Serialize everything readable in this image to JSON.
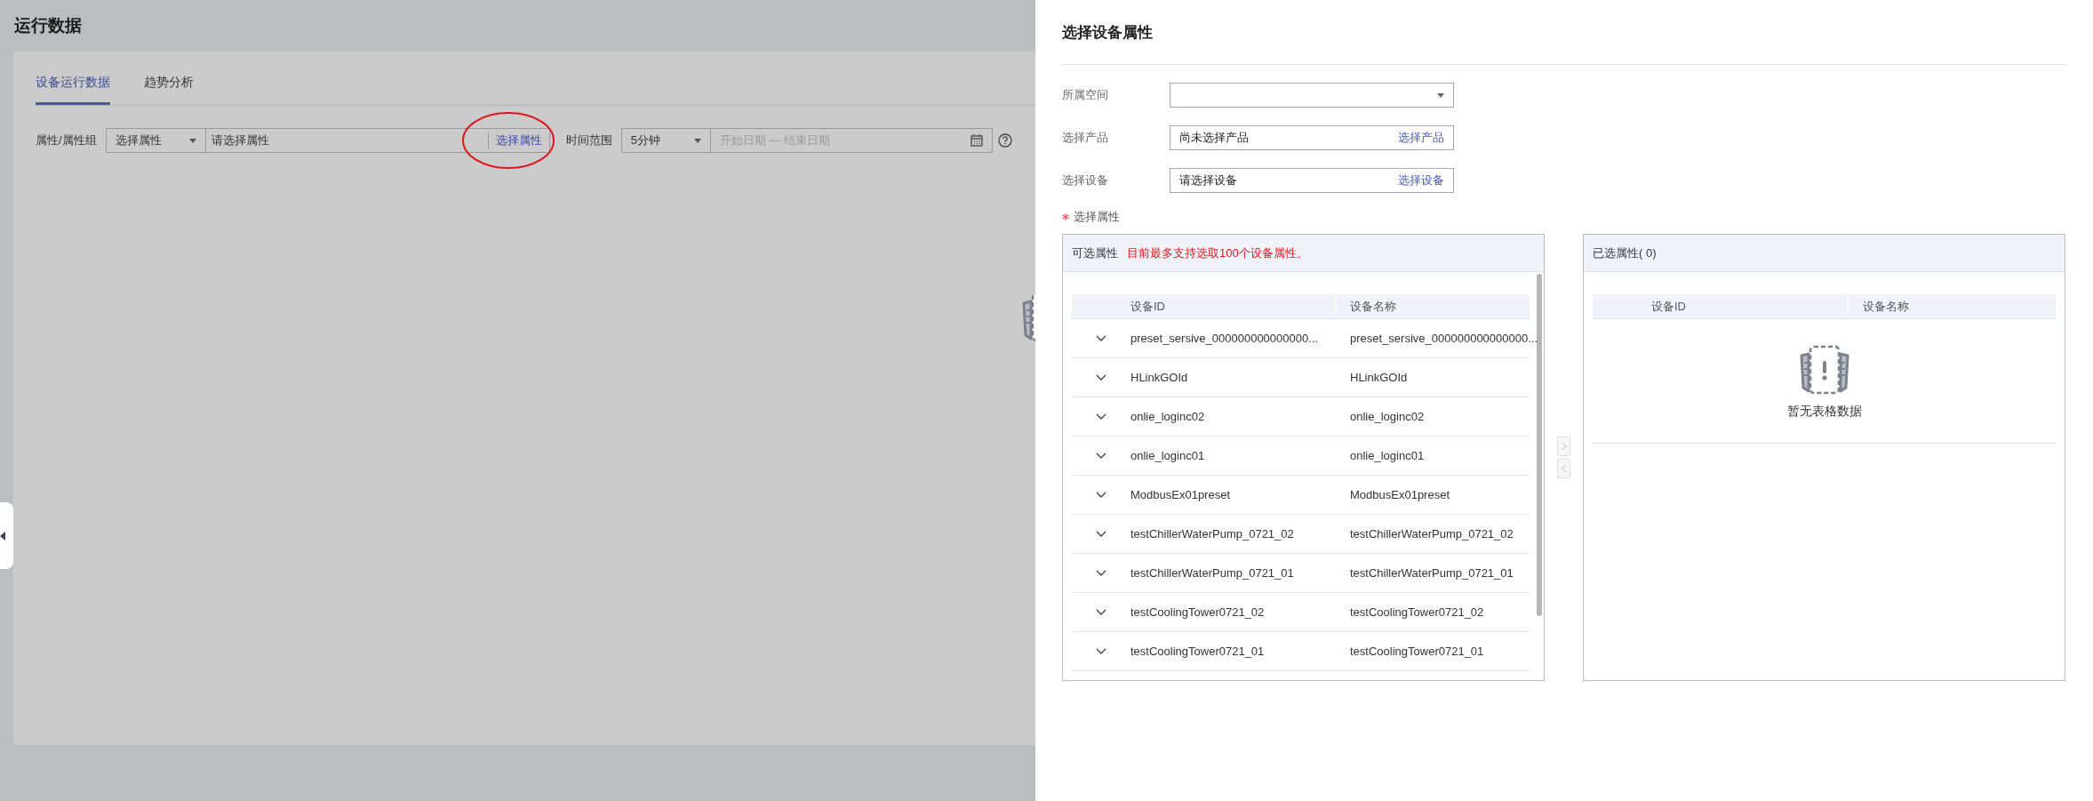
{
  "page": {
    "title": "运行数据",
    "tabs": [
      {
        "label": "设备运行数据",
        "selected": true
      },
      {
        "label": "趋势分析",
        "selected": false
      }
    ],
    "filter": {
      "attribute_label": "属性/属性组",
      "attribute_type": "选择属性",
      "attribute_placeholder": "请选择属性",
      "attribute_link": "选择属性",
      "time_label": "时间范围",
      "time_range": "5分钟",
      "date_placeholder": "开始日期 — 结束日期"
    }
  },
  "drawer": {
    "title": "选择设备属性",
    "fields": [
      {
        "label": "所属空间",
        "kind": "select"
      },
      {
        "label": "选择产品",
        "kind": "picker",
        "value": "尚未选择产品",
        "action": "选择产品"
      },
      {
        "label": "选择设备",
        "kind": "picker",
        "value": "请选择设备",
        "action": "选择设备"
      }
    ],
    "attributes_label": "选择属性",
    "required": true,
    "available": {
      "title": "可选属性",
      "notice": "目前最多支持选取100个设备属性。",
      "columns": [
        "设备ID",
        "设备名称"
      ],
      "rows": [
        {
          "id": "preset_sersive_000000000000000...",
          "name": "preset_sersive_000000000000000...",
          "expanded": false
        },
        {
          "id": "HLinkGOId",
          "name": "HLinkGOId",
          "expanded": false
        },
        {
          "id": "onlie_loginc02",
          "name": "onlie_loginc02",
          "expanded": false
        },
        {
          "id": "onlie_loginc01",
          "name": "onlie_loginc01",
          "expanded": false
        },
        {
          "id": "ModbusEx01preset",
          "name": "ModbusEx01preset",
          "expanded": false
        },
        {
          "id": "testChillerWaterPump_0721_02",
          "name": "testChillerWaterPump_0721_02",
          "expanded": false
        },
        {
          "id": "testChillerWaterPump_0721_01",
          "name": "testChillerWaterPump_0721_01",
          "expanded": false
        },
        {
          "id": "testCoolingTower0721_02",
          "name": "testCoolingTower0721_02",
          "expanded": false
        },
        {
          "id": "testCoolingTower0721_01",
          "name": "testCoolingTower0721_01",
          "expanded": false
        }
      ]
    },
    "transfer_buttons": [
      {
        "kind": "right",
        "disabled": true
      },
      {
        "kind": "left",
        "disabled": true
      }
    ],
    "chosen": {
      "title": "已选属性( 0)",
      "columns": [
        "设备ID",
        "设备名称"
      ],
      "empty_text": "暂无表格数据"
    }
  }
}
